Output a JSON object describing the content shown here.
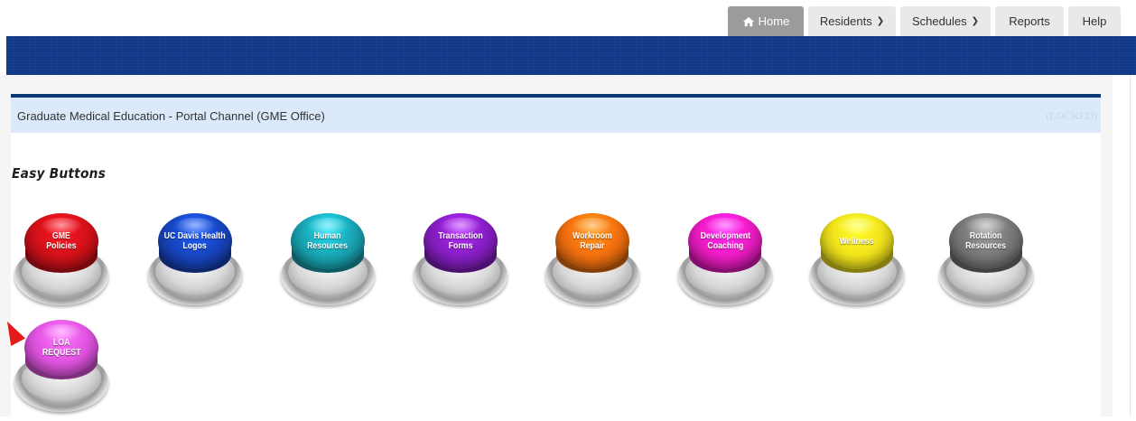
{
  "nav": {
    "tabs": [
      {
        "label": "Home",
        "active": true,
        "icon": "home-icon"
      },
      {
        "label": "Residents",
        "active": false,
        "icon": "chevron-right-icon"
      },
      {
        "label": "Schedules",
        "active": false,
        "icon": "chevron-right-icon"
      },
      {
        "label": "Reports",
        "active": false
      },
      {
        "label": "Help",
        "active": false
      }
    ]
  },
  "channel": {
    "title": "Graduate Medical Education - Portal Channel (GME Office)",
    "status": "(LOCKED)"
  },
  "easy_buttons": {
    "heading": "Easy Buttons",
    "items": [
      {
        "label": "GME\nPolicies",
        "color": "#d8111a"
      },
      {
        "label": "UC Davis Health\nLogos",
        "color": "#1847c6"
      },
      {
        "label": "Human\nResources",
        "color": "#19a9b8"
      },
      {
        "label": "Transaction\nForms",
        "color": "#8a1fc9"
      },
      {
        "label": "Workroom\nRepair",
        "color": "#f6720f"
      },
      {
        "label": "Development\nCoaching",
        "color": "#f21cc8"
      },
      {
        "label": "Wellness",
        "color": "#f2e51c"
      },
      {
        "label": "Rotation\nResources",
        "color": "#7a7a7a"
      },
      {
        "label": "LOA\nREQUEST",
        "color": "#e455e4"
      }
    ]
  },
  "colors": {
    "banner": "#123a8c",
    "channel_bar": "#dbe9fa",
    "channel_border": "#0a3874",
    "tab_active": "#9b9b9b",
    "tab_inactive": "#e9e9e9"
  }
}
